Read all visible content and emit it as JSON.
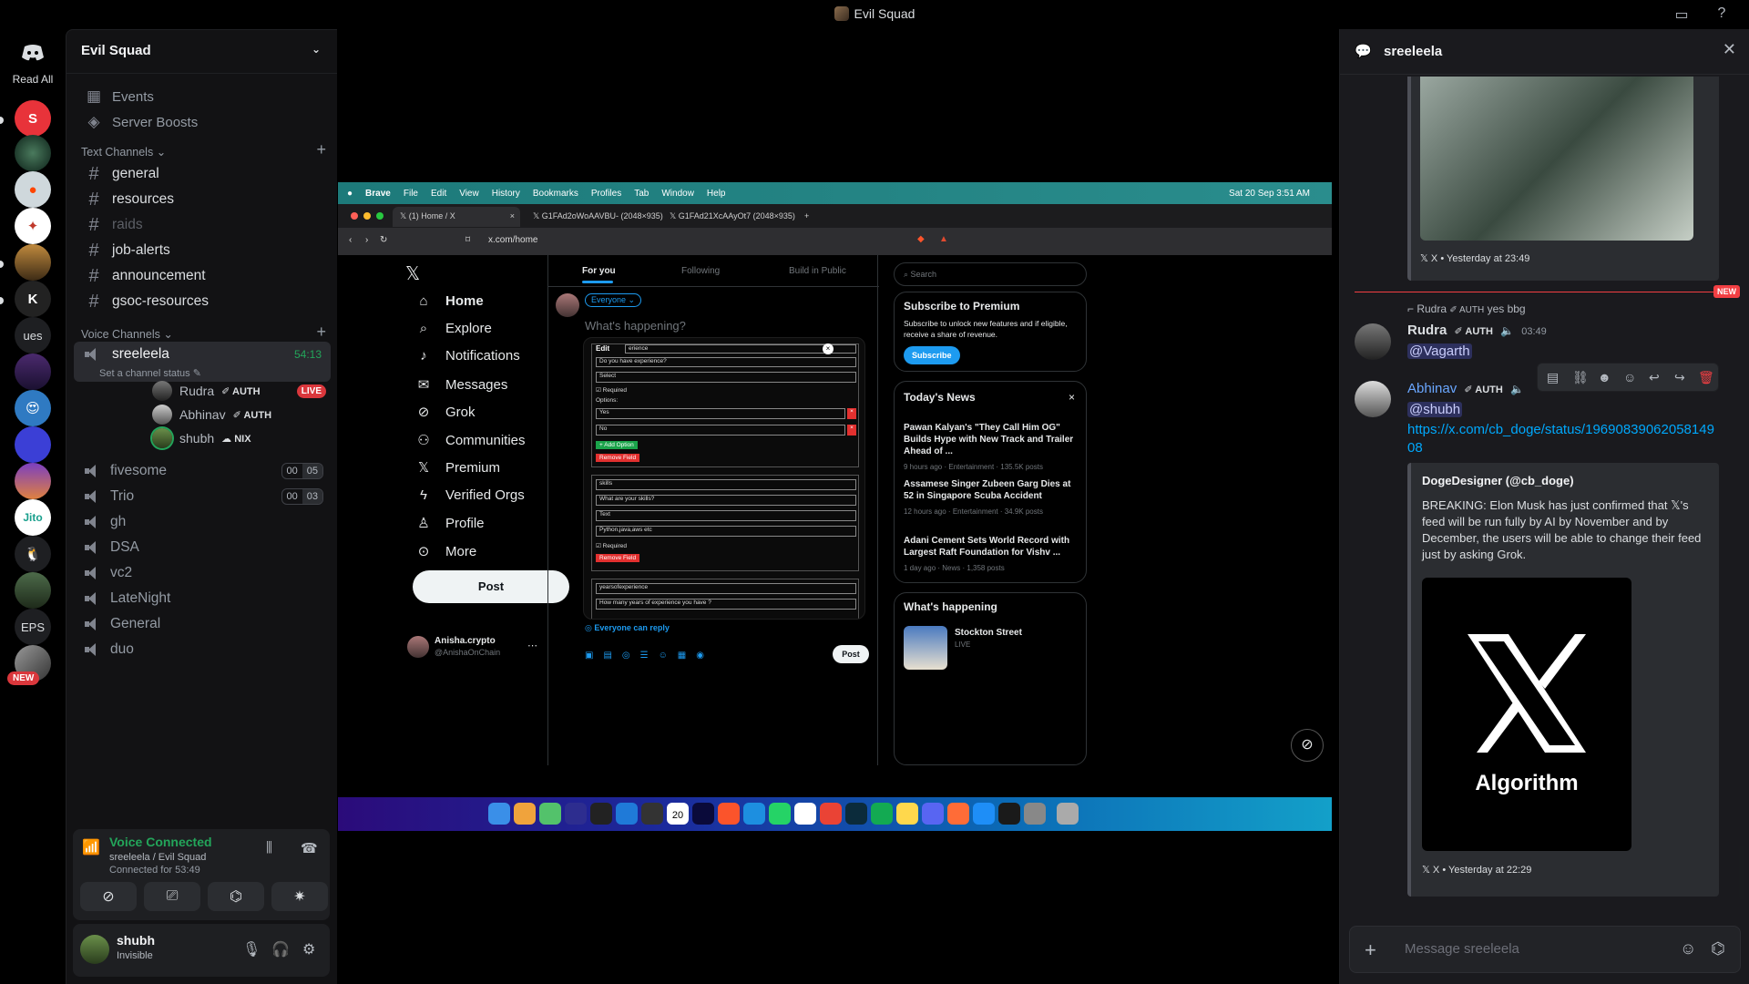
{
  "window": {
    "title": "Evil Squad"
  },
  "rail": {
    "read_all": "Read All",
    "text_guilds": [
      "ues",
      "EPS"
    ],
    "new_badge": "NEW"
  },
  "server": {
    "name": "Evil Squad",
    "events": "Events",
    "boosts": "Server Boosts",
    "text_category": "Text Channels",
    "text_channels": [
      "general",
      "resources",
      "raids",
      "job-alerts",
      "announcement",
      "gsoc-resources"
    ],
    "voice_category": "Voice Channels",
    "active_voice": {
      "name": "sreeleela",
      "timer": "54:13",
      "status_prompt": "Set a channel status",
      "users": [
        {
          "name": "Rudra",
          "tag": "AUTH",
          "live": "LIVE"
        },
        {
          "name": "Abhinav",
          "tag": "AUTH"
        },
        {
          "name": "shubh",
          "tag": "NIX"
        }
      ]
    },
    "voice_channels": [
      {
        "name": "fivesome",
        "counter": [
          "00",
          "05"
        ]
      },
      {
        "name": "Trio",
        "counter": [
          "00",
          "03"
        ]
      },
      {
        "name": "gh"
      },
      {
        "name": "DSA"
      },
      {
        "name": "vc2"
      },
      {
        "name": "LateNight"
      },
      {
        "name": "General"
      },
      {
        "name": "duo"
      }
    ]
  },
  "voice_panel": {
    "status": "Voice Connected",
    "location": "sreeleela / Evil Squad",
    "duration": "Connected for 53:49"
  },
  "user_panel": {
    "name": "shubh",
    "status": "Invisible"
  },
  "browser": {
    "menubar": [
      "Brave",
      "File",
      "Edit",
      "View",
      "History",
      "Bookmarks",
      "Profiles",
      "Tab",
      "Window",
      "Help"
    ],
    "clock": "Sat 20 Sep  3:51 AM",
    "tabs": [
      "(1) Home / X",
      "G1FAd2oWoAAVBU- (2048×935)",
      "G1FAd21XcAAyOt7 (2048×935)"
    ],
    "url": "x.com/home",
    "x": {
      "nav": [
        "Home",
        "Explore",
        "Notifications",
        "Messages",
        "Grok",
        "Communities",
        "Premium",
        "Verified Orgs",
        "Profile",
        "More"
      ],
      "post_button": "Post",
      "account_name": "Anisha.crypto",
      "account_handle": "@AnishaOnChain",
      "feed_tabs": [
        "For you",
        "Following",
        "Build in Public"
      ],
      "audience": "Everyone",
      "compose_placeholder": "What's happening?",
      "reply_setting": "Everyone can reply",
      "compose_post": "Post",
      "search_placeholder": "Search",
      "premium_title": "Subscribe to Premium",
      "premium_text": "Subscribe to unlock new features and if eligible, receive a share of revenue.",
      "premium_button": "Subscribe",
      "news_title": "Today's News",
      "news": [
        {
          "headline": "Pawan Kalyan's \"They Call Him OG\" Builds Hype with New Track and Trailer Ahead of ...",
          "meta": "9 hours ago · Entertainment · 135.5K posts"
        },
        {
          "headline": "Assamese Singer Zubeen Garg Dies at 52 in Singapore Scuba Accident",
          "meta": "12 hours ago · Entertainment · 34.9K posts"
        },
        {
          "headline": "Adani Cement Sets World Record with Largest Raft Foundation for Vishv ...",
          "meta": "1 day ago · News · 1,358 posts"
        }
      ],
      "happening_title": "What's happening",
      "happening_item": "Stockton Street",
      "happening_live": "LIVE",
      "form": {
        "edit_label": "Edit",
        "field1_name": "erience",
        "field1_question": "Do you have experience?",
        "field1_type": "Select",
        "required": "Required",
        "options_label": "Options:",
        "option_yes": "Yes",
        "option_no": "No",
        "add_option": "+ Add Option",
        "remove_field": "Remove Field",
        "field2_name": "skills",
        "field2_question": "What are your skills?",
        "field2_type": "Text",
        "field2_placeholder": "Python,java,aws etc",
        "field3_name": "yearsofexperience",
        "field3_question": "How many years of experience you have ?"
      }
    },
    "dock_date": "20"
  },
  "thread": {
    "title": "sreeleela",
    "embed1_footer": "X • Yesterday at 23:49",
    "new_label": "NEW",
    "reply_ref_name": "Rudra",
    "reply_ref_tag": "AUTH",
    "reply_ref_text": "yes bbg",
    "msg1": {
      "author": "Rudra",
      "tag": "AUTH",
      "time": "03:49",
      "mention": "@Vagarth"
    },
    "msg2": {
      "author": "Abhinav",
      "tag": "AUTH",
      "mention": "@shubh",
      "link": "https://x.com/cb_doge/status/1969083906205814908",
      "embed_author": "DogeDesigner (@cb_doge)",
      "embed_text": "BREAKING: Elon Musk has just confirmed that 𝕏's feed will be run fully by AI by November and by December, the users will be able to change their feed just by asking Grok.",
      "embed_image_text": "Algorithm",
      "embed_footer": "X • Yesterday at 22:29"
    },
    "composer_placeholder": "Message sreeleela"
  }
}
